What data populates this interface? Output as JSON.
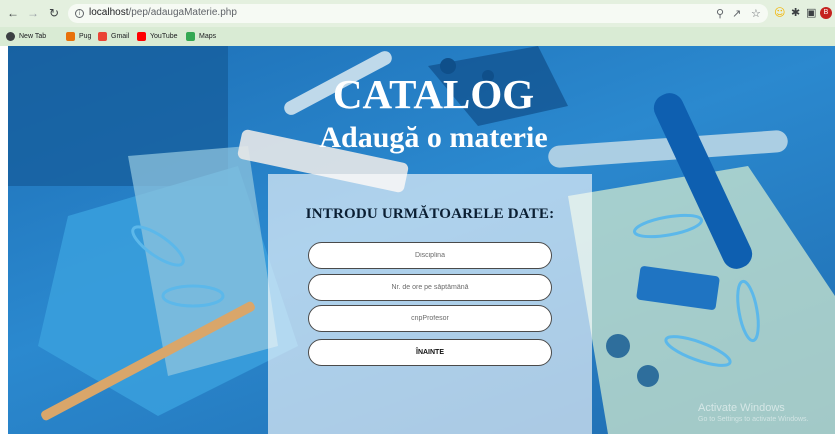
{
  "browser": {
    "url_host": "localhost",
    "url_path": "/pep/adaugaMaterie.php",
    "bookmarks": [
      {
        "label": "New Tab",
        "color": "#202124"
      },
      {
        "label": "Pug",
        "color": "#e8710a"
      },
      {
        "label": "Gmail",
        "color": "#ea4335"
      },
      {
        "label": "YouTube",
        "color": "#ff0000"
      },
      {
        "label": "Maps",
        "color": "#34a853"
      }
    ]
  },
  "page": {
    "title": "CATALOG",
    "subtitle": "Adaugă o materie",
    "form": {
      "heading": "INTRODU URMĂTOARELE DATE:",
      "discipline_placeholder": "Disciplina",
      "hours_placeholder": "Nr. de ore pe săptămână",
      "cnp_placeholder": "cnpProfesor",
      "submit_label": "ÎNAINTE"
    }
  },
  "watermark": {
    "line1": "Activate Windows",
    "line2": "Go to Settings to activate Windows."
  },
  "colors": {
    "background_blue": "#2b89cf",
    "card_overlay": "#ffffff",
    "chrome_green": "#d9ebd4"
  }
}
